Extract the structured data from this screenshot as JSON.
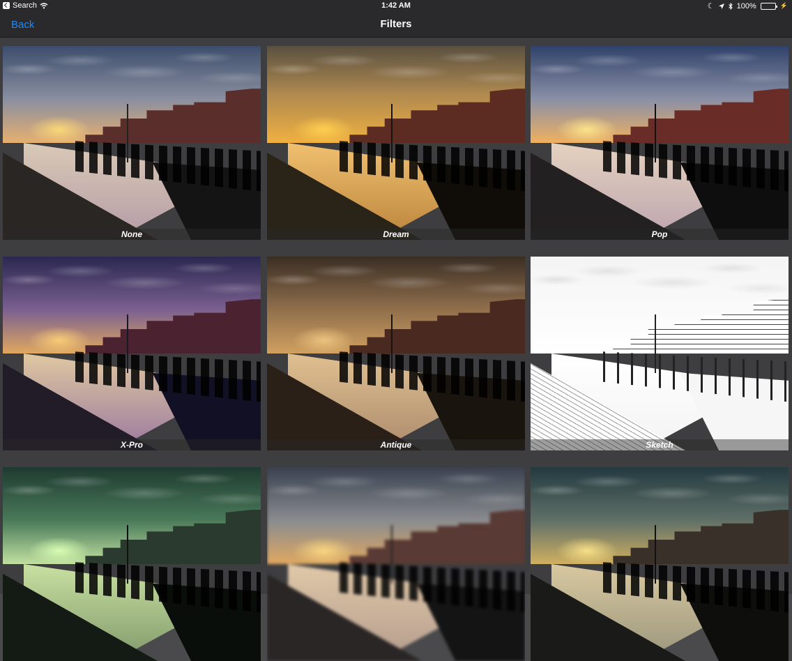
{
  "status_bar": {
    "back_app": "Search",
    "time": "1:42 AM",
    "battery": "100%",
    "battery_level": 1.0
  },
  "nav": {
    "back_label": "Back",
    "title": "Filters"
  },
  "colors": {
    "accent": "#1a8cff",
    "bar_background": "#2a2a2c",
    "battery_green": "#4cd964"
  },
  "filters": [
    {
      "label": "None"
    },
    {
      "label": "Dream"
    },
    {
      "label": "Pop"
    },
    {
      "label": "X-Pro"
    },
    {
      "label": "Antique"
    },
    {
      "label": "Sketch"
    },
    {
      "label": ""
    },
    {
      "label": ""
    },
    {
      "label": ""
    }
  ]
}
